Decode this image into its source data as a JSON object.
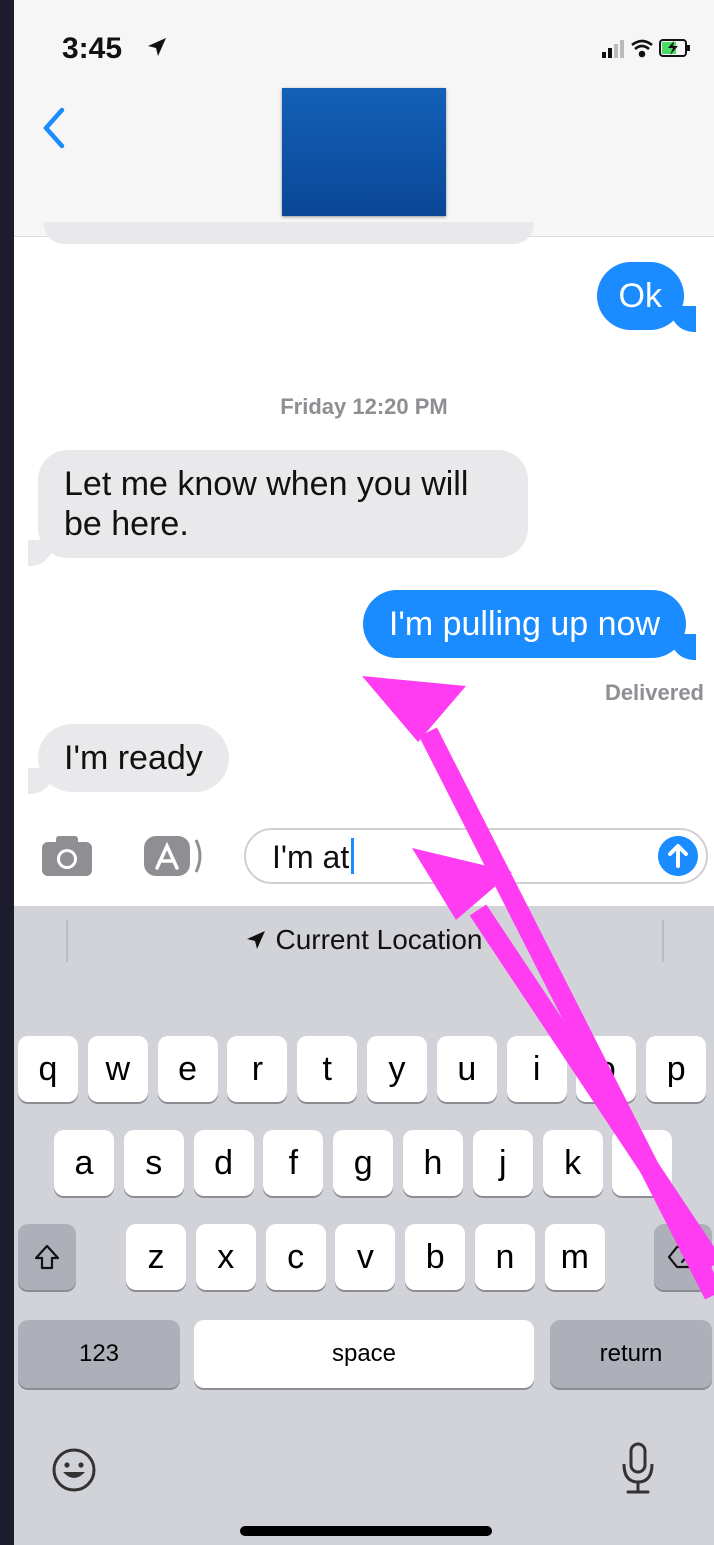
{
  "status_bar": {
    "time": "3:45"
  },
  "conversation": {
    "messages": [
      {
        "id": "ok",
        "direction": "outgoing",
        "text": "Ok"
      },
      {
        "id": "know",
        "direction": "incoming",
        "text": "Let me know when you will be here."
      },
      {
        "id": "pulling",
        "direction": "outgoing",
        "text": "I'm pulling up now"
      },
      {
        "id": "ready",
        "direction": "incoming",
        "text": "I'm ready"
      }
    ],
    "timestamp": "Friday 12:20 PM",
    "delivered_label": "Delivered"
  },
  "compose": {
    "value": "I'm at"
  },
  "keyboard": {
    "suggestion": "Current Location",
    "row1": [
      "q",
      "w",
      "e",
      "r",
      "t",
      "y",
      "u",
      "i",
      "o",
      "p"
    ],
    "row2": [
      "a",
      "s",
      "d",
      "f",
      "g",
      "h",
      "j",
      "k",
      "l"
    ],
    "row3": [
      "z",
      "x",
      "c",
      "v",
      "b",
      "n",
      "m"
    ],
    "numbers_label": "123",
    "space_label": "space",
    "return_label": "return"
  },
  "icons": {
    "back": "chevron-left-icon",
    "camera": "camera-icon",
    "app_store": "app-store-icon",
    "send": "arrow-up-icon",
    "shift": "shift-icon",
    "delete": "delete-icon",
    "emoji": "emoji-icon",
    "mic": "microphone-icon",
    "location": "location-arrow-icon"
  },
  "colors": {
    "accent": "#1a8cff",
    "incoming_bubble": "#e9e9eb",
    "annotation_arrow": "#ff3cf2",
    "avatar_redaction": "#0b4fa3"
  }
}
